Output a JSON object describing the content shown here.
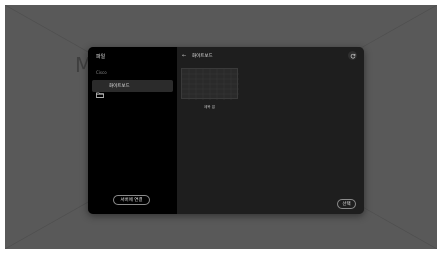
{
  "background": {
    "partial_letter": "M"
  },
  "sidebar": {
    "title": "파일",
    "section_label": "Cisco",
    "items": [
      {
        "label": "화이트보드",
        "icon": "folder-icon",
        "selected": true
      }
    ],
    "connect_button_label": "서버에 연결"
  },
  "main": {
    "back_icon": "back-arrow-icon",
    "title": "화이트보드",
    "refresh_icon": "refresh-icon",
    "files": [
      {
        "name": "제목 없",
        "thumbnail": "whiteboard-thumbnail"
      }
    ],
    "select_button_label": "선택"
  },
  "colors": {
    "backdrop": "#595959",
    "sidebar_bg": "#000000",
    "panel_bg": "#1e1e1e",
    "selected_item_bg": "#2b2b2b",
    "text": "#e6e6e6",
    "muted_text": "#8a8a8a"
  }
}
